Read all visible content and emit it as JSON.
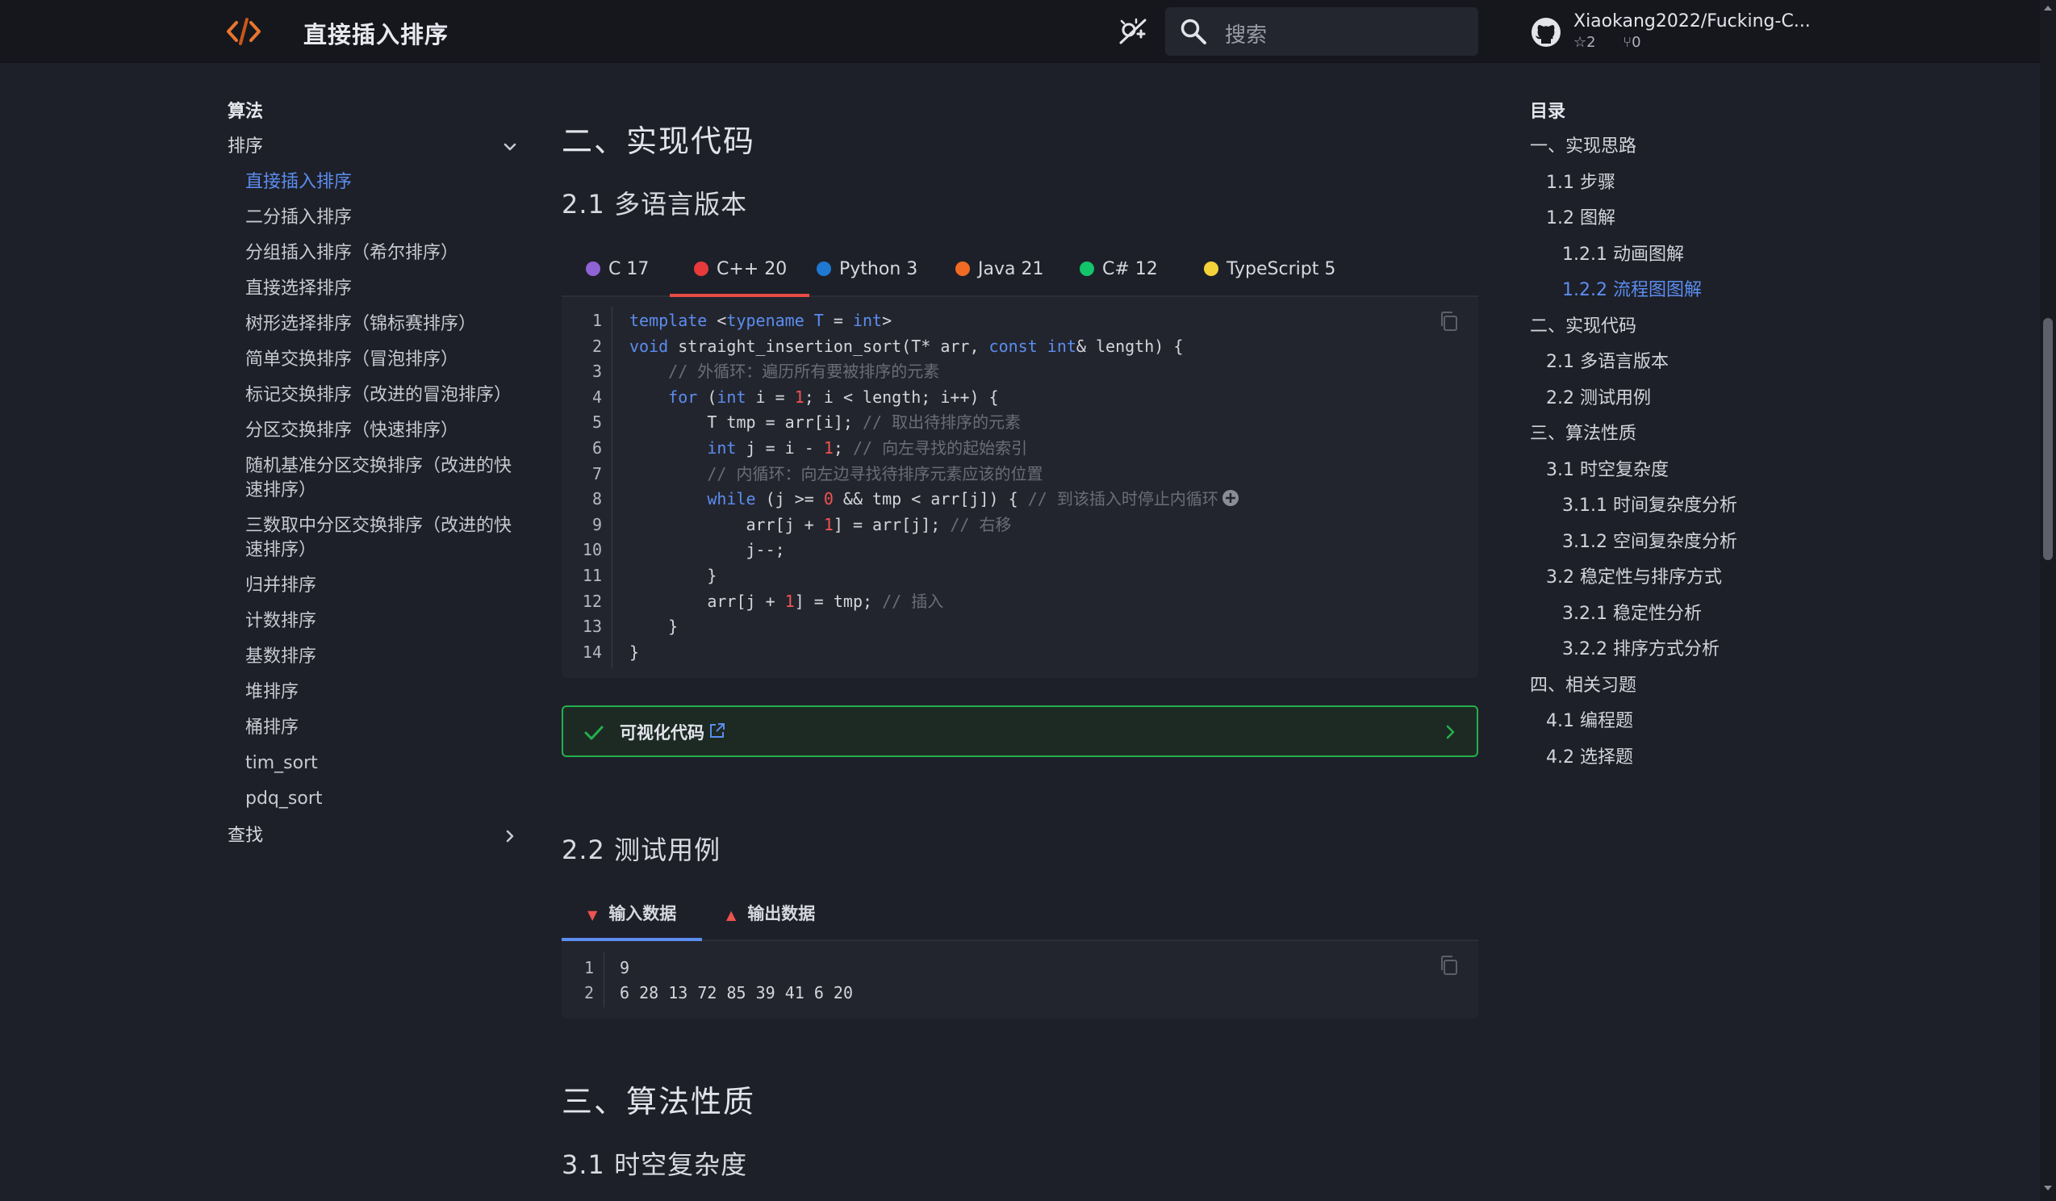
{
  "header": {
    "title": "直接插入排序",
    "search_placeholder": "搜索",
    "repo_name": "Xiaokang2022/Fucking-C...",
    "stars": "2",
    "forks": "0"
  },
  "sidebar": {
    "section": "算法",
    "group_sort": "排序",
    "items": [
      "直接插入排序",
      "二分插入排序",
      "分组插入排序（希尔排序）",
      "直接选择排序",
      "树形选择排序（锦标赛排序）",
      "简单交换排序（冒泡排序）",
      "标记交换排序（改进的冒泡排序）",
      "分区交换排序（快速排序）",
      "随机基准分区交换排序（改进的快速排序）",
      "三数取中分区交换排序（改进的快速排序）",
      "归并排序",
      "计数排序",
      "基数排序",
      "堆排序",
      "桶排序",
      "tim_sort",
      "pdq_sort"
    ],
    "active_index": 0,
    "group_search": "查找"
  },
  "main": {
    "h2_impl": "二、实现代码",
    "h3_multi": "2.1 多语言版本",
    "tabs": [
      {
        "label": "C 17",
        "color": "#8e63d6"
      },
      {
        "label": "C++ 20",
        "color": "#e8393b"
      },
      {
        "label": "Python 3",
        "color": "#1f78d1"
      },
      {
        "label": "Java 21",
        "color": "#f26b24"
      },
      {
        "label": "C# 12",
        "color": "#12c46a"
      },
      {
        "label": "TypeScript 5",
        "color": "#f3d23a"
      }
    ],
    "active_tab": 1,
    "code_lines": [
      "1",
      "2",
      "3",
      "4",
      "5",
      "6",
      "7",
      "8",
      "9",
      "10",
      "11",
      "12",
      "13",
      "14"
    ],
    "code": {
      "l1_a": "template",
      "l1_b": " <",
      "l1_c": "typename",
      "l1_d": " ",
      "l1_e": "T",
      "l1_f": " = ",
      "l1_g": "int",
      "l1_h": ">",
      "l2_a": "void",
      "l2_b": " straight_insertion_sort(T* arr, ",
      "l2_c": "const",
      "l2_d": " ",
      "l2_e": "int",
      "l2_f": "& length) {",
      "l3": "    // 外循环：遍历所有要被排序的元素",
      "l4_a": "    ",
      "l4_b": "for",
      "l4_c": " (",
      "l4_d": "int",
      "l4_e": " i = ",
      "l4_f": "1",
      "l4_g": "; i < length; i++) {",
      "l5_a": "        T tmp = arr[i]; ",
      "l5_b": "// 取出待排序的元素",
      "l6_a": "        ",
      "l6_b": "int",
      "l6_c": " j = i - ",
      "l6_d": "1",
      "l6_e": "; ",
      "l6_f": "// 向左寻找的起始索引",
      "l7": "        // 内循环：向左边寻找待排序元素应该的位置",
      "l8_a": "        ",
      "l8_b": "while",
      "l8_c": " (j >= ",
      "l8_d": "0",
      "l8_e": " && tmp < arr[j]) { ",
      "l8_f": "// 到该插入时停止内循环",
      "l9_a": "            arr[j + ",
      "l9_b": "1",
      "l9_c": "] = arr[j]; ",
      "l9_d": "// 右移",
      "l10": "            j--;",
      "l11": "        }",
      "l12_a": "        arr[j + ",
      "l12_b": "1",
      "l12_c": "] = tmp; ",
      "l12_d": "// 插入",
      "l13": "    }",
      "l14": "}"
    },
    "visual_label": "可视化代码",
    "h3_test": "2.2 测试用例",
    "io_tabs": [
      "输入数据",
      "输出数据"
    ],
    "io_lines": [
      {
        "n": "1",
        "text": "9"
      },
      {
        "n": "2",
        "text": "6 28 13 72 85 39 41 6 20"
      }
    ],
    "h2_props": "三、算法性质",
    "h3_complex": "3.1 时空复杂度"
  },
  "toc": {
    "title": "目录",
    "items": [
      {
        "label": "一、实现思路",
        "level": 1
      },
      {
        "label": "1.1 步骤",
        "level": 2
      },
      {
        "label": "1.2 图解",
        "level": 2
      },
      {
        "label": "1.2.1 动画图解",
        "level": 3
      },
      {
        "label": "1.2.2 流程图图解",
        "level": 3
      },
      {
        "label": "二、实现代码",
        "level": 1
      },
      {
        "label": "2.1 多语言版本",
        "level": 2
      },
      {
        "label": "2.2 测试用例",
        "level": 2
      },
      {
        "label": "三、算法性质",
        "level": 1
      },
      {
        "label": "3.1 时空复杂度",
        "level": 2
      },
      {
        "label": "3.1.1 时间复杂度分析",
        "level": 3
      },
      {
        "label": "3.1.2 空间复杂度分析",
        "level": 3
      },
      {
        "label": "3.2 稳定性与排序方式",
        "level": 2
      },
      {
        "label": "3.2.1 稳定性分析",
        "level": 3
      },
      {
        "label": "3.2.2 排序方式分析",
        "level": 3
      },
      {
        "label": "四、相关习题",
        "level": 1
      },
      {
        "label": "4.1 编程题",
        "level": 2
      },
      {
        "label": "4.2 选择题",
        "level": 2
      }
    ],
    "active_index": 4
  },
  "colors": {
    "accent": "#5b8def",
    "success": "#22b14c",
    "logo": "#e8762c"
  }
}
